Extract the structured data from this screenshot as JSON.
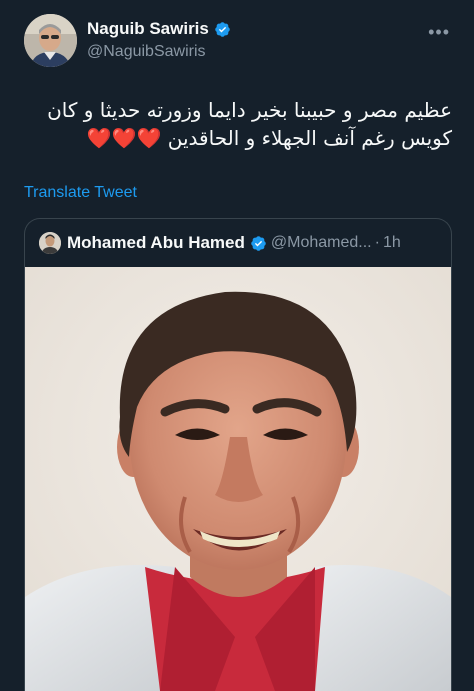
{
  "author": {
    "display_name": "Naguib Sawiris",
    "handle": "@NaguibSawiris",
    "verified": true
  },
  "more_icon": "more-horizontal-icon",
  "tweet": {
    "lines": [
      "عظيم مصر و حبيبنا بخير دايما وزورته حديثا و كان",
      "كويس رغم آنف الجهلاء و الحاقدين ❤️❤️❤️"
    ]
  },
  "translate_label": "Translate Tweet",
  "quoted_tweet": {
    "display_name": "Mohamed Abu Hamed",
    "handle": "@Mohamed...",
    "separator": "·",
    "time": "1h",
    "verified": true
  },
  "colors": {
    "background": "#15202b",
    "text": "#f7f9f9",
    "secondary": "#8b98a5",
    "link": "#1d9bf0",
    "verified": "#1d9bf0",
    "border": "#38444d"
  }
}
